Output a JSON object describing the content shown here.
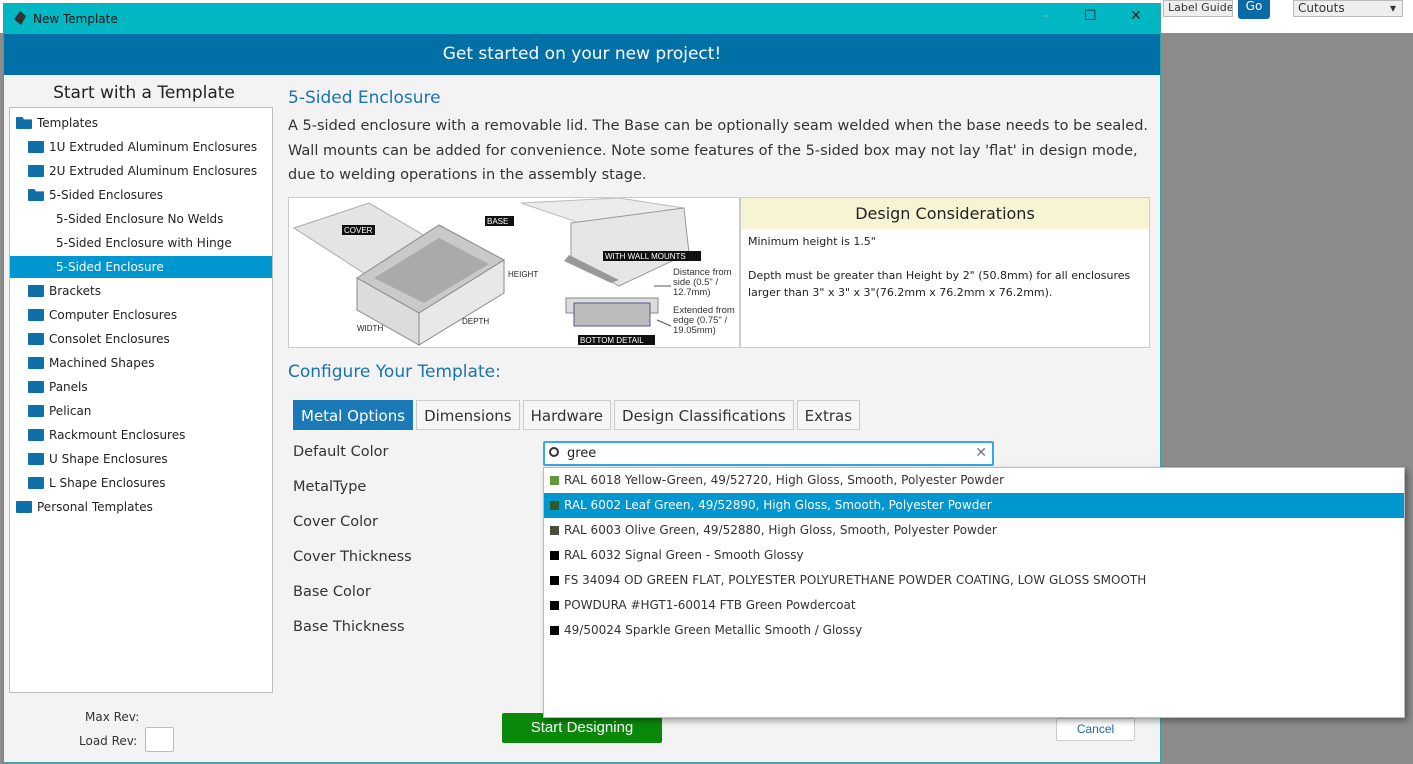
{
  "bg_toolbar": {
    "dropdown1": "Label Guide",
    "go": "Go",
    "dropdown2": "Cutouts"
  },
  "window": {
    "title": "New Template",
    "minimize": "–",
    "maximize": "☐",
    "close": "✕"
  },
  "banner": "Get started on your new project!",
  "left": {
    "title": "Start with a Template",
    "tree": [
      {
        "label": "Templates",
        "level": 0,
        "folder": "open"
      },
      {
        "label": "1U Extruded Aluminum Enclosures",
        "level": 1,
        "folder": "closed"
      },
      {
        "label": "2U Extruded Aluminum Enclosures",
        "level": 1,
        "folder": "closed"
      },
      {
        "label": "5-Sided Enclosures",
        "level": 1,
        "folder": "open"
      },
      {
        "label": "5-Sided Enclosure No Welds",
        "level": 2
      },
      {
        "label": "5-Sided Enclosure with Hinge",
        "level": 2
      },
      {
        "label": "5-Sided Enclosure",
        "level": 2,
        "selected": true
      },
      {
        "label": "Brackets",
        "level": 1,
        "folder": "closed"
      },
      {
        "label": "Computer Enclosures",
        "level": 1,
        "folder": "closed"
      },
      {
        "label": "Consolet Enclosures",
        "level": 1,
        "folder": "closed"
      },
      {
        "label": "Machined Shapes",
        "level": 1,
        "folder": "closed"
      },
      {
        "label": "Panels",
        "level": 1,
        "folder": "closed"
      },
      {
        "label": "Pelican",
        "level": 1,
        "folder": "closed"
      },
      {
        "label": "Rackmount Enclosures",
        "level": 1,
        "folder": "closed"
      },
      {
        "label": "U Shape Enclosures",
        "level": 1,
        "folder": "closed"
      },
      {
        "label": "L Shape Enclosures",
        "level": 1,
        "folder": "closed"
      },
      {
        "label": "Personal Templates",
        "level": 0,
        "folder": "closed"
      }
    ],
    "max_rev": "Max Rev:",
    "load_rev": "Load Rev:"
  },
  "template": {
    "title": "5-Sided Enclosure",
    "description": "A 5-sided enclosure with a removable lid. The Base can be optionally seam welded when the base needs to be sealed. Wall mounts can be added for convenience. Note some features of the 5-sided box may not lay 'flat' in design mode, due to welding operations in the assembly stage.",
    "image_labels": {
      "cover": "COVER",
      "base": "BASE",
      "height": "HEIGHT",
      "width": "WIDTH",
      "depth": "DEPTH",
      "wall": "WITH WALL MOUNTS",
      "bottom": "BOTTOM DETAIL",
      "dist": "Distance from side (0.5\" / 12.7mm)",
      "ext": "Extended from edge (0.75\" / 19.05mm)"
    }
  },
  "design_considerations": {
    "title": "Design Considerations",
    "line1": "Minimum height is 1.5\"",
    "line2": "Depth must be greater than Height by 2\" (50.8mm) for all enclosures larger than 3\" x 3\" x 3\"(76.2mm x 76.2mm x 76.2mm)."
  },
  "configure": {
    "title": "Configure Your Template:",
    "tabs": [
      "Metal Options",
      "Dimensions",
      "Hardware",
      "Design Classifications",
      "Extras"
    ],
    "active_tab": 0,
    "fields": [
      "Default Color",
      "MetalType",
      "Cover Color",
      "Cover Thickness",
      "Base Color",
      "Base Thickness"
    ],
    "search_value": "gree",
    "options": [
      {
        "label": "RAL 6018 Yellow-Green, 49/52720, High Gloss, Smooth, Polyester Powder",
        "color": "#5e9b38"
      },
      {
        "label": "RAL 6002 Leaf Green, 49/52890, High Gloss, Smooth, Polyester Powder",
        "color": "#2d5a27",
        "selected": true
      },
      {
        "label": "RAL 6003 Olive Green, 49/52880, High Gloss, Smooth, Polyester Powder",
        "color": "#4a4d3a"
      },
      {
        "label": "RAL 6032 Signal Green - Smooth Glossy",
        "color": "#000000"
      },
      {
        "label": "FS 34094 OD GREEN FLAT, POLYESTER POLYURETHANE POWDER COATING, LOW GLOSS SMOOTH",
        "color": "#000000"
      },
      {
        "label": "POWDURA #HGT1-60014 FTB Green Powdercoat",
        "color": "#000000"
      },
      {
        "label": "49/50024 Sparkle Green Metallic Smooth / Glossy",
        "color": "#000000"
      }
    ]
  },
  "buttons": {
    "start": "Start Designing",
    "cancel": "Cancel"
  }
}
